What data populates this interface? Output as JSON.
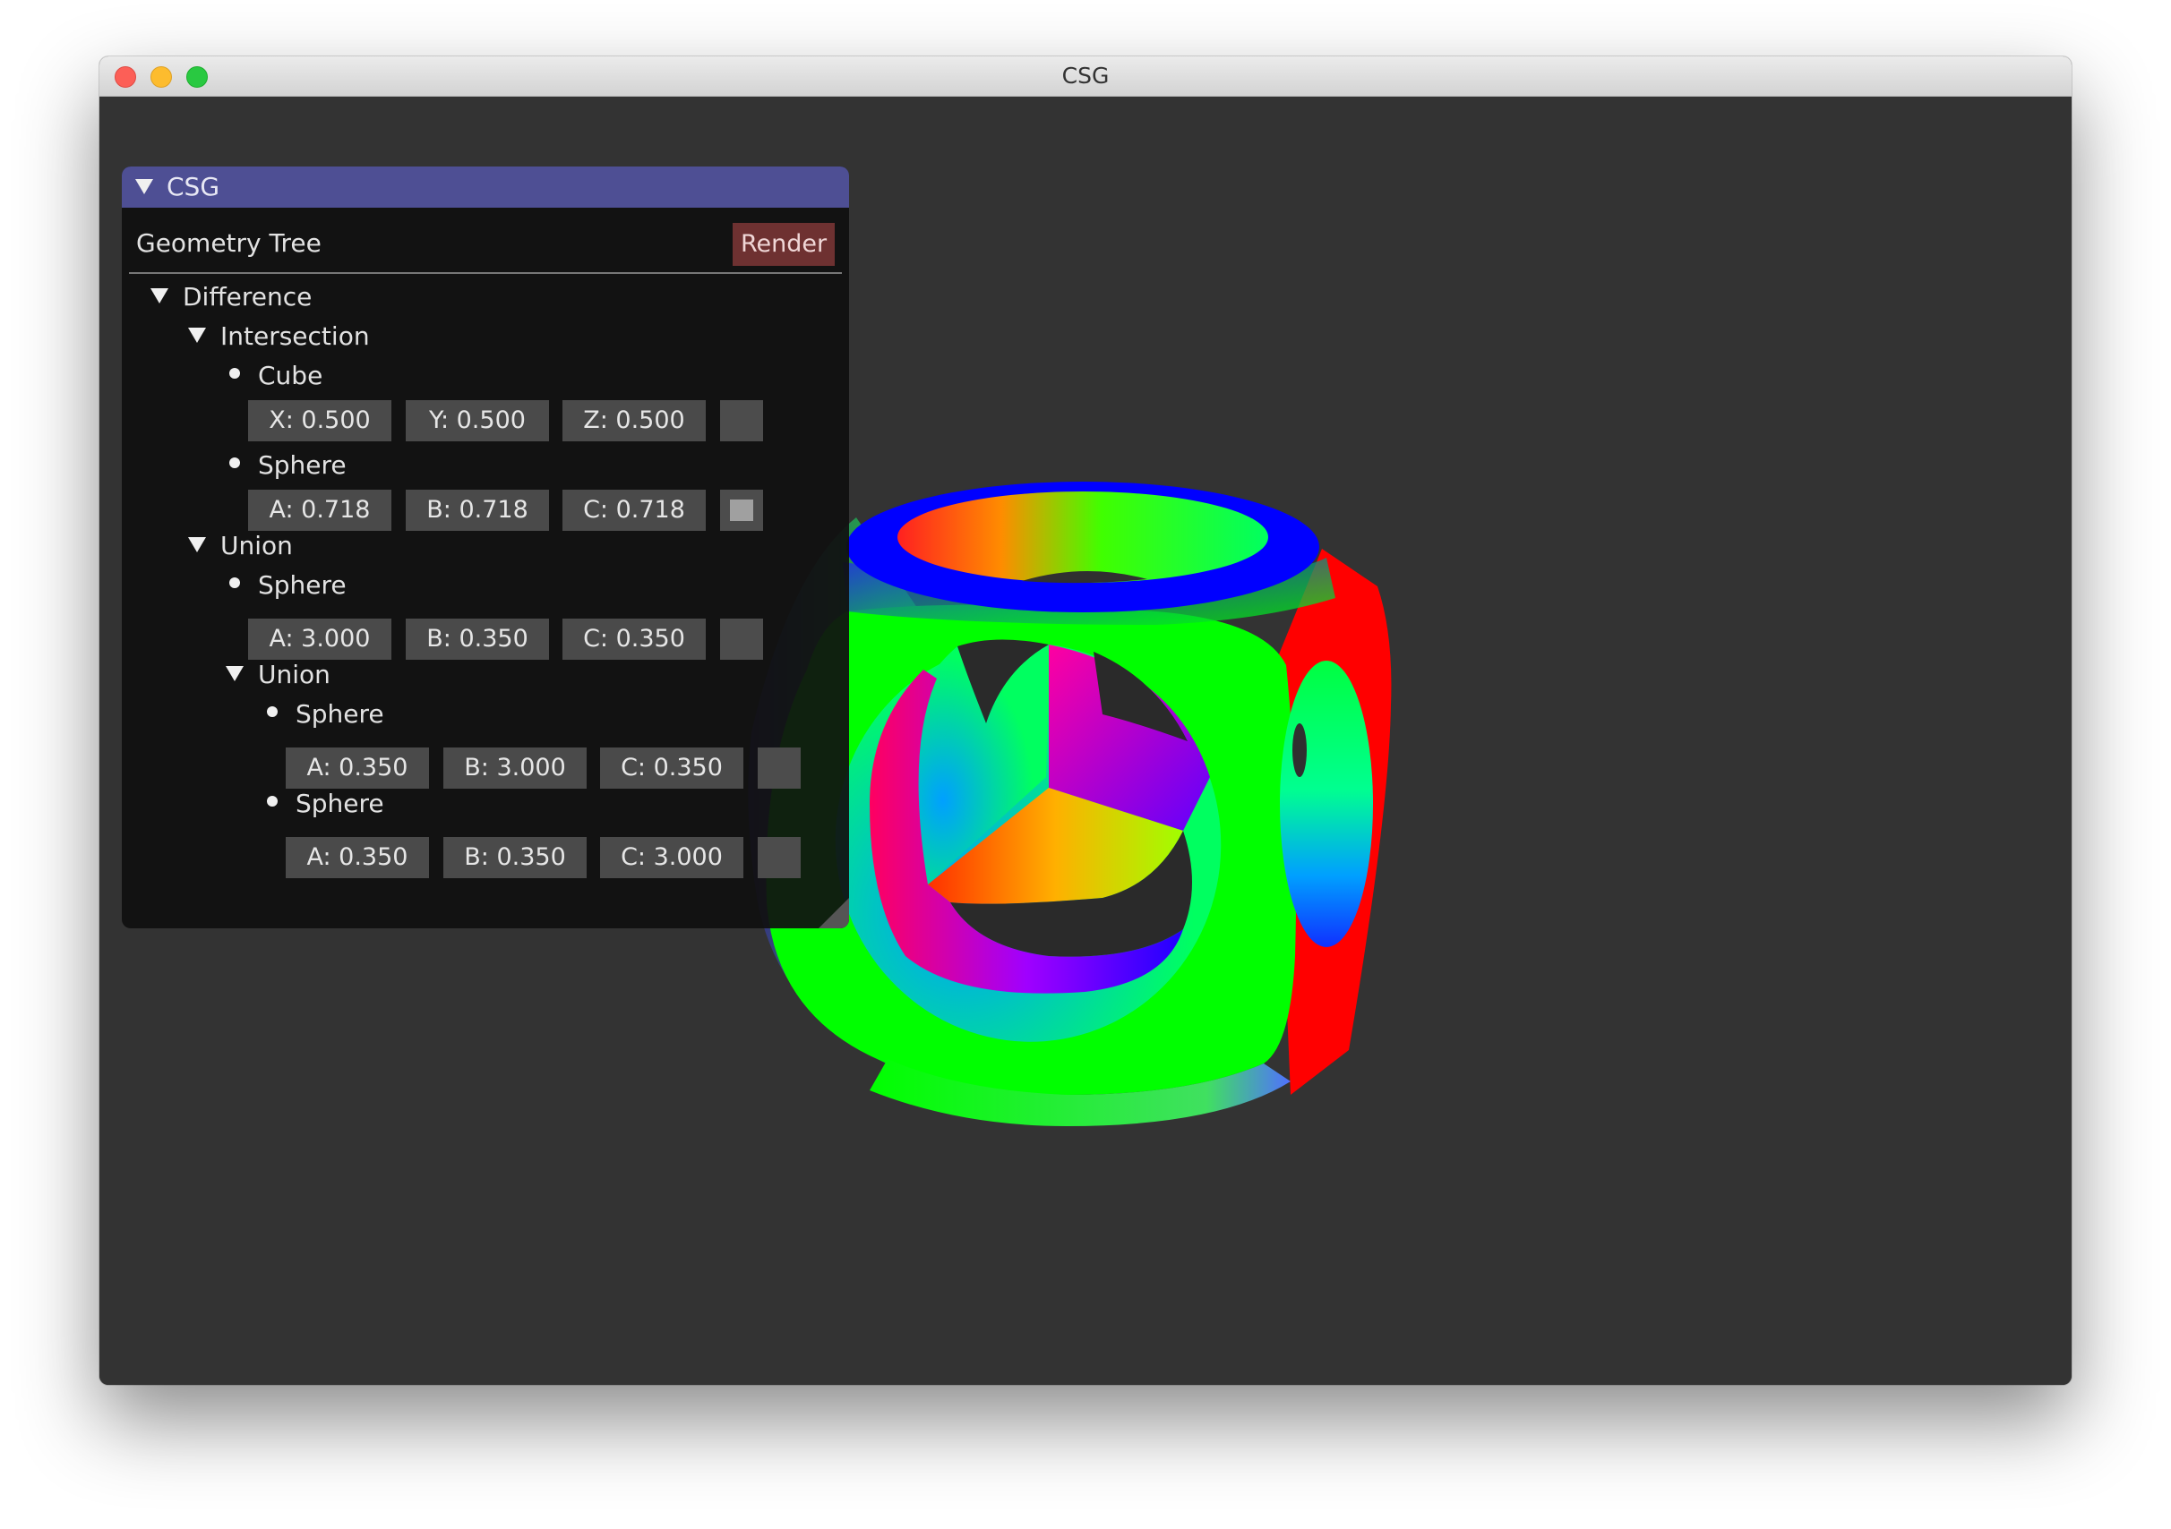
{
  "window": {
    "title": "CSG"
  },
  "panel": {
    "title": "CSG",
    "heading": "Geometry Tree",
    "render_label": "Render",
    "tree": [
      {
        "label": "Difference"
      },
      {
        "label": "Intersection"
      },
      {
        "label": "Cube",
        "fields": [
          "X: 0.500",
          "Y: 0.500",
          "Z: 0.500"
        ]
      },
      {
        "label": "Sphere",
        "fields": [
          "A: 0.718",
          "B: 0.718",
          "C: 0.718"
        ]
      },
      {
        "label": "Union"
      },
      {
        "label": "Sphere",
        "fields": [
          "A: 3.000",
          "B: 0.350",
          "C: 0.350"
        ]
      },
      {
        "label": "Union"
      },
      {
        "label": "Sphere",
        "fields": [
          "A: 0.350",
          "B: 3.000",
          "C: 0.350"
        ]
      },
      {
        "label": "Sphere",
        "fields": [
          "A: 0.350",
          "B: 0.350",
          "C: 3.000"
        ]
      }
    ]
  },
  "colors": {
    "viewport_bg": "#333333",
    "panel_header": "#4e4f94",
    "render_button": "#6e3131",
    "normal_red": "#ff0000",
    "normal_green": "#00ff00",
    "normal_blue": "#0000ff"
  }
}
